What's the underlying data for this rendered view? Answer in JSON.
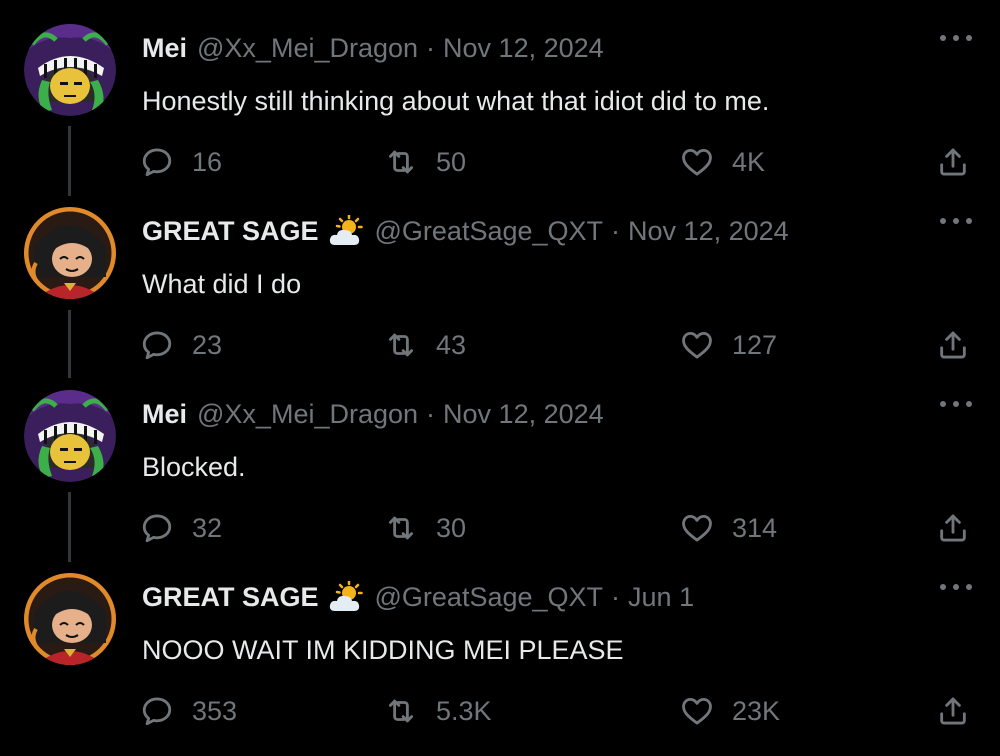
{
  "colors": {
    "background": "#000000",
    "text_primary": "#e7e9ea",
    "text_secondary": "#71767b",
    "thread_line": "#333639"
  },
  "icons": {
    "reply": "speech-bubble-icon",
    "retweet": "retweet-arrows-icon",
    "like": "heart-icon",
    "share": "share-upload-icon",
    "more": "three-dots-icon",
    "badge": "sun-behind-cloud-icon"
  },
  "tweets": [
    {
      "name": "Mei",
      "handle": "@Xx_Mei_Dragon",
      "date": "Nov 12, 2024",
      "text": "Honestly still thinking about what that idiot did to me.",
      "replies": "16",
      "retweets": "50",
      "likes": "4K"
    },
    {
      "name": "GREAT SAGE",
      "handle": "@GreatSage_QXT",
      "date": "Nov 12, 2024",
      "text": "What did I do",
      "replies": "23",
      "retweets": "43",
      "likes": "127"
    },
    {
      "name": "Mei",
      "handle": "@Xx_Mei_Dragon",
      "date": "Nov 12, 2024",
      "text": "Blocked.",
      "replies": "32",
      "retweets": "30",
      "likes": "314"
    },
    {
      "name": "GREAT SAGE",
      "handle": "@GreatSage_QXT",
      "date": "Jun 1",
      "text": "NOOO WAIT IM KIDDING MEI PLEASE",
      "replies": "353",
      "retweets": "5.3K",
      "likes": "23K"
    }
  ]
}
